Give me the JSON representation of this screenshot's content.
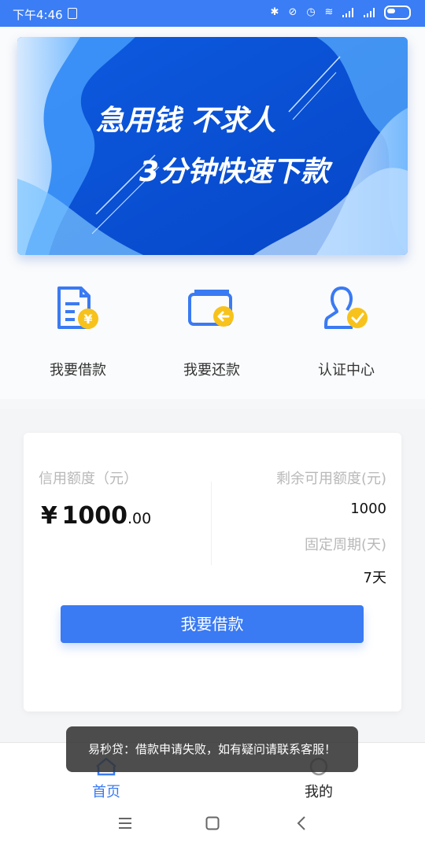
{
  "status_bar": {
    "time": "下午4:46",
    "icons": [
      "sim-card-icon",
      "bluetooth-icon",
      "mute-icon",
      "alarm-icon",
      "wifi-icon",
      "signal-icon",
      "signal-icon",
      "battery-icon"
    ]
  },
  "banner": {
    "line1": "急用钱 不求人",
    "line2": "3分钟快速下款",
    "colors": {
      "dark": "#0a4fd6",
      "light": "#bfe2ff"
    }
  },
  "quick_actions": [
    {
      "label": "我要借款",
      "icon": "loan-document-icon"
    },
    {
      "label": "我要还款",
      "icon": "repay-wallet-icon"
    },
    {
      "label": "认证中心",
      "icon": "verified-user-icon"
    }
  ],
  "credit_card": {
    "credit_label": "信用额度（元）",
    "currency": "¥",
    "amount_main": "1000",
    "amount_decimal": ".00",
    "remaining_label": "剩余可用额度(元)",
    "remaining_value": "1000",
    "period_label": "固定周期(天)",
    "period_value": "7天",
    "button_label": "我要借款"
  },
  "tabs": [
    {
      "label": "首页",
      "icon": "home-icon",
      "active": true
    },
    {
      "label": "我的",
      "icon": "profile-icon",
      "active": false
    }
  ],
  "toast": {
    "text": "易秒贷：借款申请失败，如有疑问请联系客服！"
  },
  "nav_bar": {
    "icons": [
      "menu-icon",
      "home-square-icon",
      "back-icon"
    ]
  },
  "colors": {
    "accent": "#3a7af3",
    "status_bar": "#3a7df5",
    "badge_yellow": "#f7c21b"
  }
}
